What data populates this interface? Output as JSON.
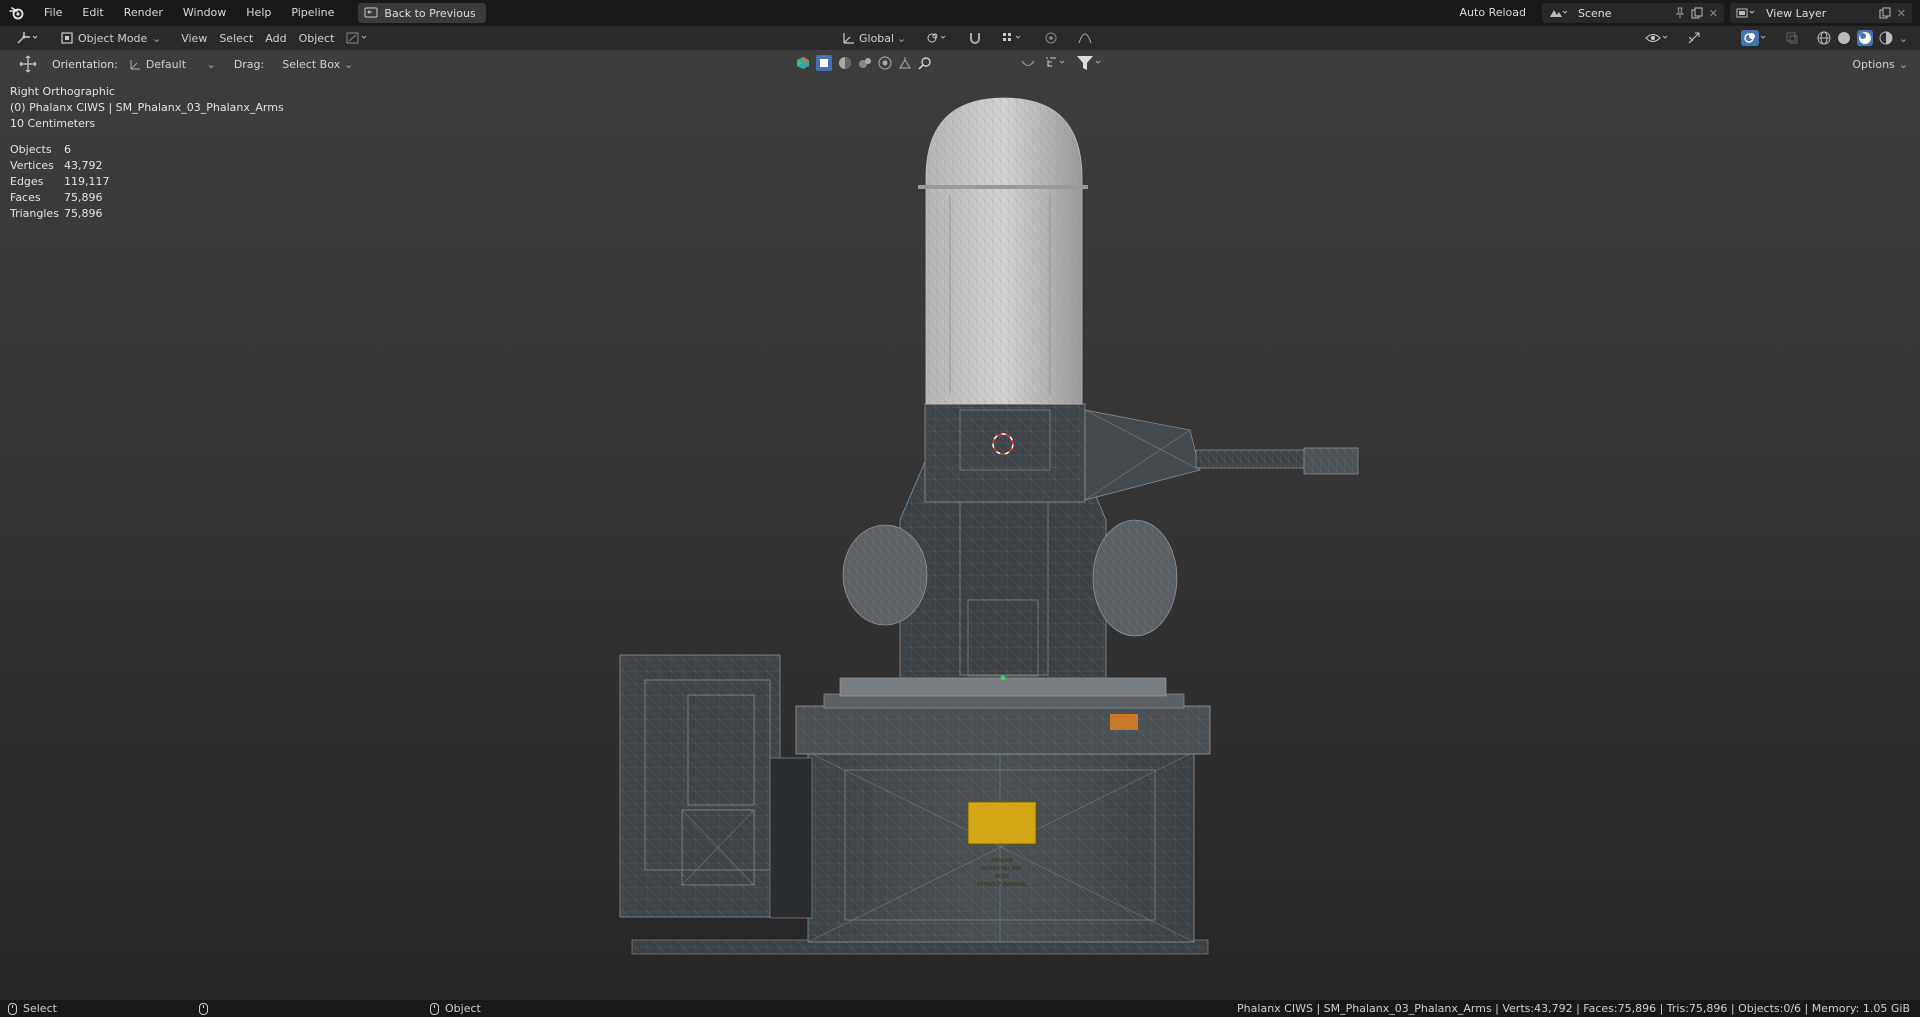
{
  "topbar": {
    "menu": [
      "File",
      "Edit",
      "Render",
      "Window",
      "Help",
      "Pipeline"
    ],
    "back_label": "Back to Previous",
    "auto_reload": "Auto Reload",
    "scene": "Scene",
    "view_layer": "View Layer"
  },
  "header": {
    "mode": "Object Mode",
    "menus": [
      "View",
      "Select",
      "Add",
      "Object"
    ],
    "transform_orientation": "Global",
    "options": "Options"
  },
  "tool_header": {
    "orientation_label": "Orientation:",
    "orientation_value": "Default",
    "drag_label": "Drag:",
    "drag_value": "Select Box"
  },
  "viewport": {
    "view_name": "Right Orthographic",
    "collection_info": "(0) Phalanx CIWS | SM_Phalanx_03_Phalanx_Arms",
    "scale": "10 Centimeters",
    "stats": [
      {
        "label": "Objects",
        "value": "6"
      },
      {
        "label": "Vertices",
        "value": "43,792"
      },
      {
        "label": "Edges",
        "value": "119,117"
      },
      {
        "label": "Faces",
        "value": "75,896"
      },
      {
        "label": "Triangles",
        "value": "75,896"
      }
    ],
    "warning_sign": [
      "DANGER",
      "MOUNTING MAY",
      "MOVE",
      "WITHOUT WARNING"
    ]
  },
  "statusbar": {
    "select": "Select",
    "object": "Object",
    "info": "Phalanx CIWS | SM_Phalanx_03_Phalanx_Arms | Verts:43,792 | Faces:75,896 | Tris:75,896 | Objects:0/6 | Memory: 1.05 GiB"
  },
  "colors": {
    "accent": "#4772b3",
    "background": "#1d1d1d",
    "warning_sign": "#d4a514"
  }
}
